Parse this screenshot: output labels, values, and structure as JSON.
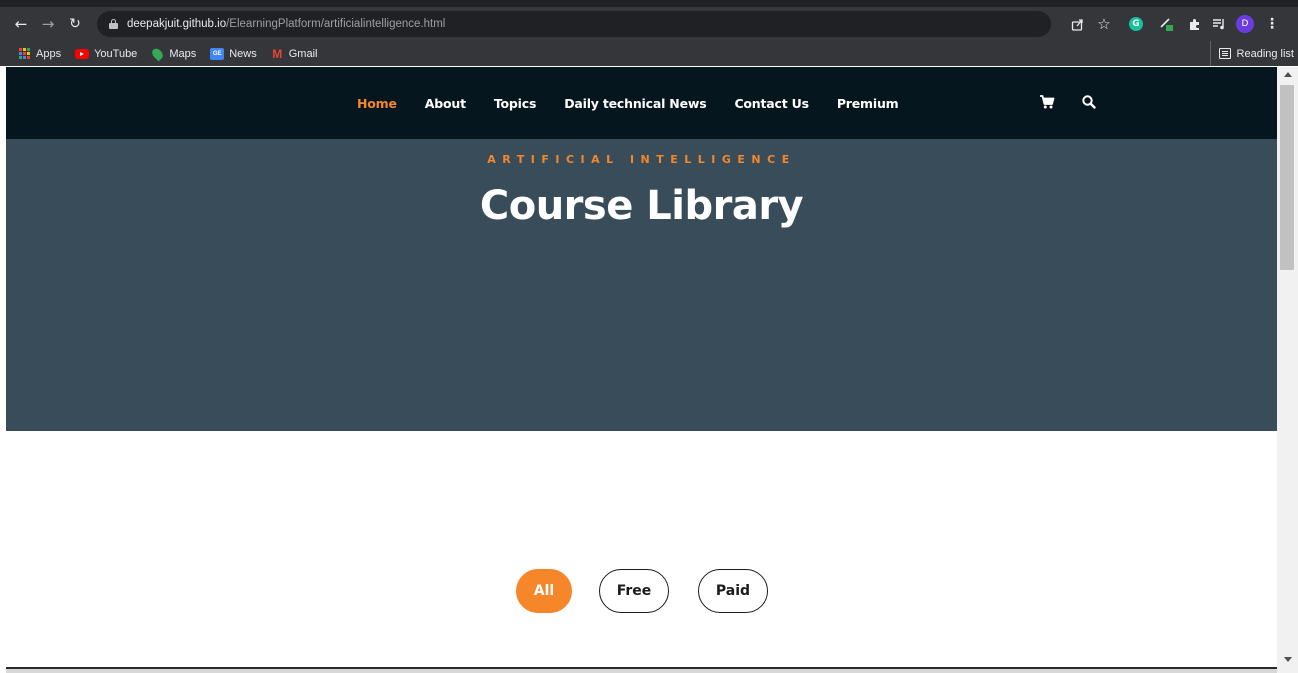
{
  "browser": {
    "url_host": "deepakjuit.github.io",
    "url_path": "/ElearningPlatform/artificialintelligence.html",
    "avatar_initial": "D",
    "grammarly_letter": "G"
  },
  "bookmarks": {
    "items": [
      {
        "label": "Apps",
        "icon": "apps-grid-icon"
      },
      {
        "label": "YouTube",
        "icon": "youtube-icon"
      },
      {
        "label": "Maps",
        "icon": "maps-icon"
      },
      {
        "label": "News",
        "icon": "news-icon"
      },
      {
        "label": "Gmail",
        "icon": "gmail-icon"
      }
    ],
    "reading_list": "Reading list"
  },
  "site_nav": {
    "items": [
      {
        "label": "Home",
        "active": true
      },
      {
        "label": "About"
      },
      {
        "label": "Topics"
      },
      {
        "label": "Daily technical News"
      },
      {
        "label": "Contact Us"
      },
      {
        "label": "Premium"
      }
    ],
    "icons": [
      "cart-icon",
      "search-icon"
    ]
  },
  "hero": {
    "eyebrow": "ARTIFICIAL INTELLIGENCE",
    "title": "Course Library"
  },
  "filters": {
    "items": [
      {
        "label": "All",
        "active": true
      },
      {
        "label": "Free"
      },
      {
        "label": "Paid"
      }
    ]
  },
  "colors": {
    "accent": "#f5862a",
    "nav_bg": "#06161f",
    "hero_bg": "#384d59"
  }
}
